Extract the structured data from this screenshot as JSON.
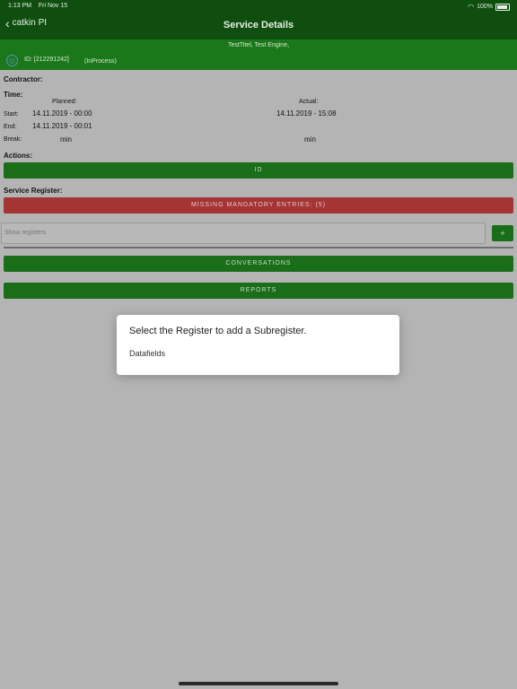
{
  "status_bar": {
    "time": "1:13 PM",
    "date": "Fri Nov 15",
    "battery": "100%"
  },
  "nav": {
    "back_label": "catkin PI",
    "title": "Service Details"
  },
  "info": {
    "title": "TestTitel, Test Engine,",
    "id": "ID: [212291242]",
    "state": "(InProcess)"
  },
  "contractor_label": "Contractor:",
  "time": {
    "label": "Time:",
    "planned_header": "Planned:",
    "actual_header": "Actual:",
    "start_label": "Start:",
    "end_label": "End:",
    "break_label": "Break:",
    "planned_start": "14.11.2019 - 00:00",
    "planned_end": "14.11.2019 - 00:01",
    "planned_break": "min",
    "actual_start": "14.11.2019 - 15:08",
    "actual_break": "min"
  },
  "actions": {
    "label": "Actions:",
    "id_button": "ID"
  },
  "service_register": {
    "label": "Service Register:",
    "missing_button": "MISSING MANDATORY ENTRIES: (5)",
    "search_placeholder": "Show registers",
    "add_button": "+"
  },
  "buttons": {
    "conversations": "CONVERSATIONS",
    "reports": "REPORTS"
  },
  "dialog": {
    "title": "Select the Register to add a Subregister.",
    "items": [
      "Datafields"
    ]
  }
}
